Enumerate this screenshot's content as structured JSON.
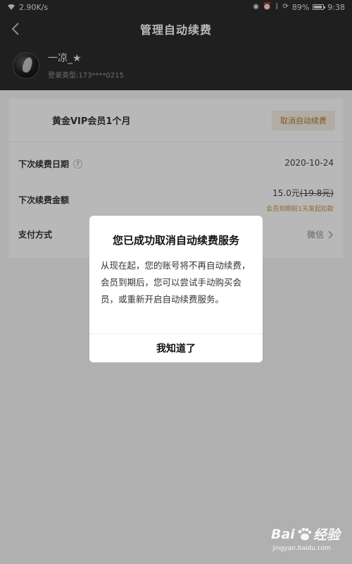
{
  "status_bar": {
    "network_speed": "2.90K/s",
    "battery": "89%",
    "time": "9:38"
  },
  "header": {
    "title": "管理自动续费",
    "username": "一凉_★",
    "login_type": "登录类型:173****0215"
  },
  "card": {
    "plan_name": "黄金VIP会员1个月",
    "cancel_label": "取消自动续费",
    "next_date_label": "下次续费日期",
    "next_date_value": "2020-10-24",
    "next_amount_label": "下次续费金额",
    "price": "15.0元",
    "original_price": "(19.8元)",
    "deduct_note": "会员到期前1天发起扣款",
    "pay_method_label": "支付方式",
    "pay_method_value": "微信"
  },
  "dialog": {
    "title": "您已成功取消自动续费服务",
    "body": "从现在起，您的账号将不再自动续费，会员到期后，您可以尝试手动购买会员，或重新开启自动续费服务。",
    "ok_label": "我知道了"
  },
  "watermark": {
    "brand": "Bai",
    "brand_suffix": "经验",
    "url": "jingyan.baidu.com"
  },
  "colors": {
    "header_bg": "#2b2b2b",
    "accent": "#b07a2e",
    "note": "#c8913c"
  }
}
